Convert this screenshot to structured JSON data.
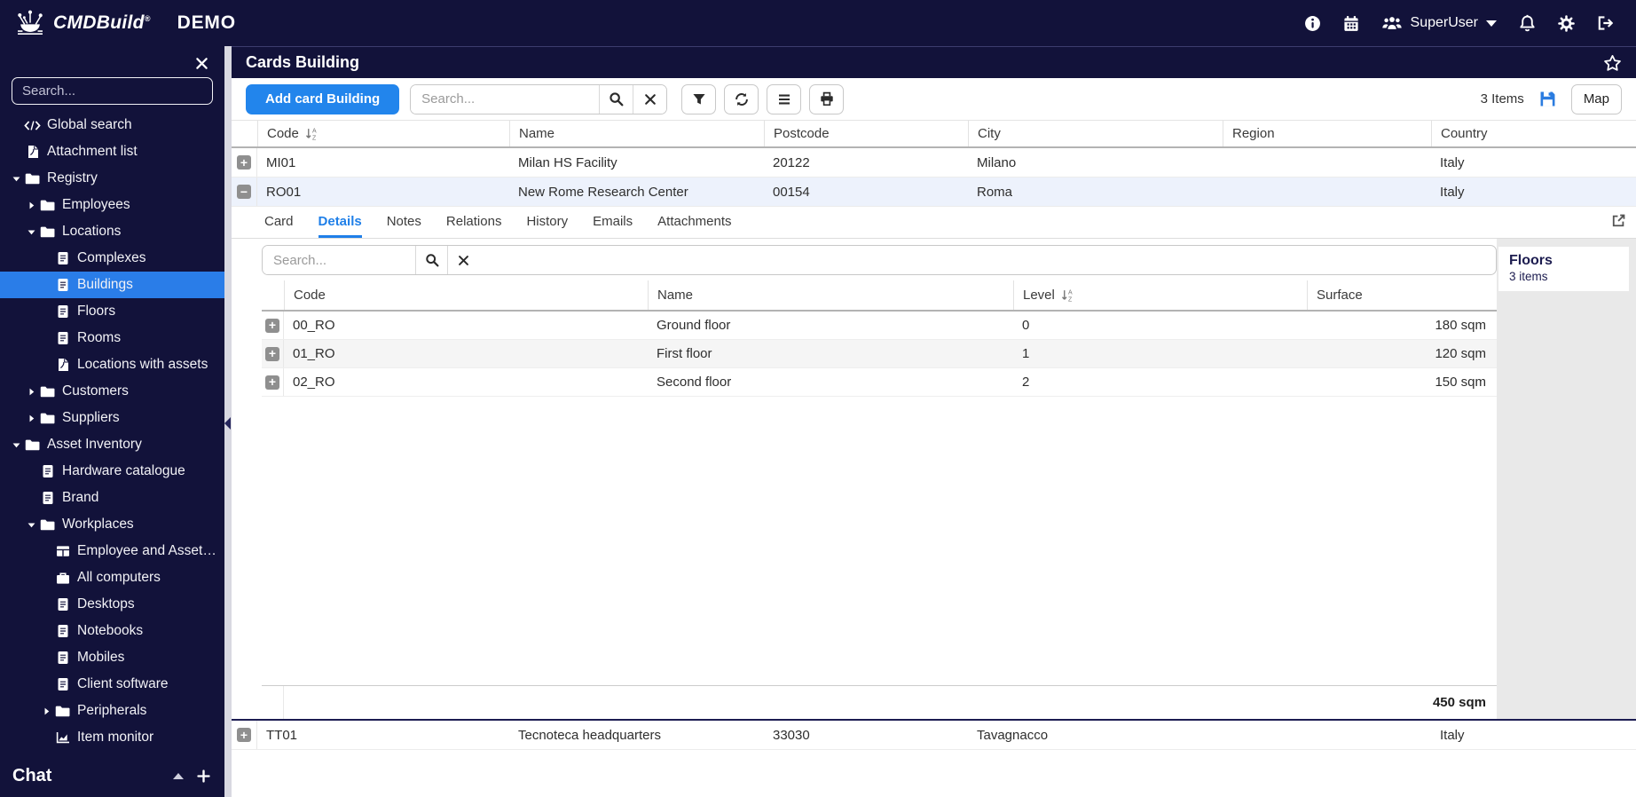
{
  "topbar": {
    "brand": "CMDBuild",
    "trademark": "®",
    "env_label": "DEMO",
    "user_name": "SuperUser"
  },
  "sidebar": {
    "search_placeholder": "Search...",
    "tree": [
      {
        "label": "Global search",
        "icon": "code",
        "level": 0
      },
      {
        "label": "Attachment list",
        "icon": "file",
        "level": 0
      },
      {
        "label": "Registry",
        "icon": "folder",
        "state": "expanded",
        "level": 0
      },
      {
        "label": "Employees",
        "icon": "folder",
        "state": "collapsed",
        "level": 1
      },
      {
        "label": "Locations",
        "icon": "folder",
        "state": "expanded",
        "level": 1
      },
      {
        "label": "Complexes",
        "icon": "document",
        "level": 2
      },
      {
        "label": "Buildings",
        "icon": "document",
        "level": 2,
        "selected": true
      },
      {
        "label": "Floors",
        "icon": "document",
        "level": 2
      },
      {
        "label": "Rooms",
        "icon": "document",
        "level": 2
      },
      {
        "label": "Locations with assets",
        "icon": "file",
        "level": 2
      },
      {
        "label": "Customers",
        "icon": "folder",
        "state": "collapsed",
        "level": 1
      },
      {
        "label": "Suppliers",
        "icon": "folder",
        "state": "collapsed",
        "level": 1
      },
      {
        "label": "Asset Inventory",
        "icon": "folder",
        "state": "expanded",
        "level": 0
      },
      {
        "label": "Hardware catalogue",
        "icon": "document",
        "level": 1
      },
      {
        "label": "Brand",
        "icon": "document",
        "level": 1
      },
      {
        "label": "Workplaces",
        "icon": "folder",
        "state": "expanded",
        "level": 1
      },
      {
        "label": "Employee and Assets i…",
        "icon": "table",
        "level": 2
      },
      {
        "label": "All computers",
        "icon": "briefcase",
        "level": 2
      },
      {
        "label": "Desktops",
        "icon": "document",
        "level": 2
      },
      {
        "label": "Notebooks",
        "icon": "document",
        "level": 2
      },
      {
        "label": "Mobiles",
        "icon": "document",
        "level": 2
      },
      {
        "label": "Client software",
        "icon": "document",
        "level": 2
      },
      {
        "label": "Peripherals",
        "icon": "folder",
        "state": "collapsed",
        "level": 2
      },
      {
        "label": "Item monitor",
        "icon": "chart",
        "level": 2
      }
    ],
    "chat": {
      "title": "Chat"
    }
  },
  "page": {
    "title": "Cards Building"
  },
  "toolbar": {
    "add_button": "Add card Building",
    "search_placeholder": "Search...",
    "items_count": "3 Items",
    "map_button": "Map"
  },
  "grid": {
    "columns": [
      "Code",
      "Name",
      "Postcode",
      "City",
      "Region",
      "Country"
    ],
    "sorted_column": "Code",
    "rows": [
      {
        "code": "MI01",
        "name": "Milan HS Facility",
        "postcode": "20122",
        "city": "Milano",
        "region": "",
        "country": "Italy"
      },
      {
        "code": "RO01",
        "name": "New Rome Research Center",
        "postcode": "00154",
        "city": "Roma",
        "region": "",
        "country": "Italy"
      },
      {
        "code": "TT01",
        "name": "Tecnoteca headquarters",
        "postcode": "33030",
        "city": "Tavagnacco",
        "region": "",
        "country": "Italy"
      }
    ]
  },
  "detail": {
    "tabs": [
      "Card",
      "Details",
      "Notes",
      "Relations",
      "History",
      "Emails",
      "Attachments"
    ],
    "active_tab": "Details",
    "search_placeholder": "Search...",
    "columns": [
      "Code",
      "Name",
      "Level",
      "Surface"
    ],
    "sorted_column": "Level",
    "rows": [
      {
        "code": "00_RO",
        "name": "Ground floor",
        "level": "0",
        "surface": "180 sqm"
      },
      {
        "code": "01_RO",
        "name": "First floor",
        "level": "1",
        "surface": "120 sqm"
      },
      {
        "code": "02_RO",
        "name": "Second floor",
        "level": "2",
        "surface": "150 sqm"
      }
    ],
    "total_surface": "450 sqm",
    "side_panel": {
      "title": "Floors",
      "subtitle": "3 items"
    }
  },
  "colors": {
    "navy": "#12123a",
    "accent_blue": "#2285ec",
    "selected_row": "#edf2fc",
    "side_panel_gray": "#e9e9e9"
  }
}
